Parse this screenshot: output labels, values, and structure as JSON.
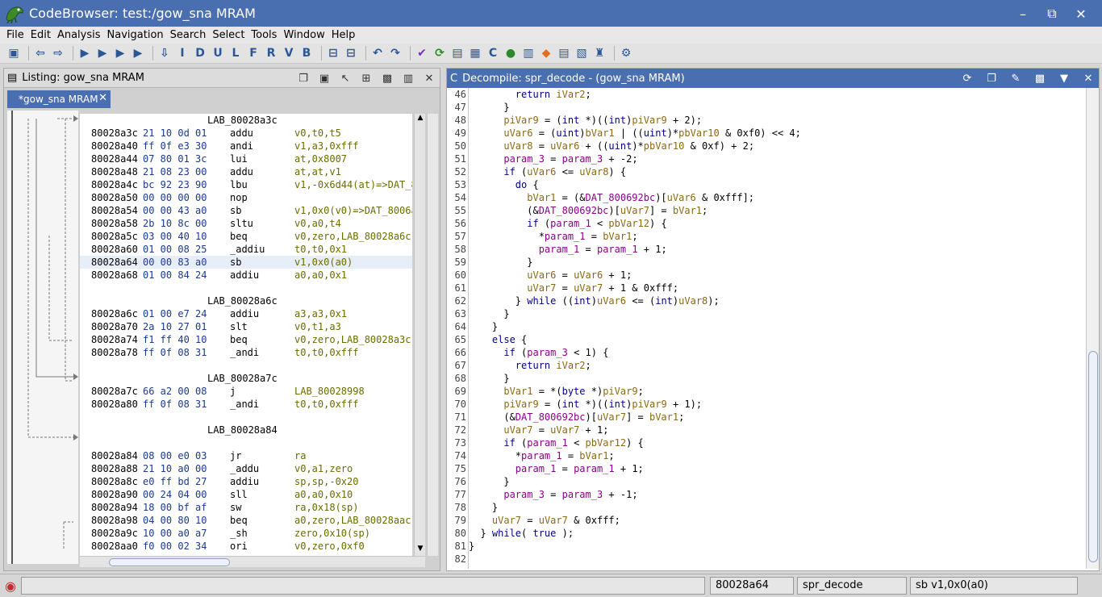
{
  "window": {
    "title": "CodeBrowser: test:/gow_sna MRAM",
    "min": "–",
    "max": "☐",
    "restore": "⧉",
    "close": "✕"
  },
  "menu": [
    "File",
    "Edit",
    "Analysis",
    "Navigation",
    "Search",
    "Select",
    "Tools",
    "Window",
    "Help"
  ],
  "listing": {
    "title": "Listing:  gow_sna MRAM",
    "tab": "*gow_sna MRAM",
    "rows": [
      {
        "type": "label",
        "text": "LAB_80028a3c"
      },
      {
        "type": "insn",
        "addr": "80028a3c",
        "bytes": "21 10 0d 01",
        "mn": "addu",
        "op": "v0,t0,t5"
      },
      {
        "type": "insn",
        "addr": "80028a40",
        "bytes": "ff 0f e3 30",
        "mn": "andi",
        "op": "v1,a3,0xfff"
      },
      {
        "type": "insn",
        "addr": "80028a44",
        "bytes": "07 80 01 3c",
        "mn": "lui",
        "op": "at,0x8007"
      },
      {
        "type": "insn",
        "addr": "80028a48",
        "bytes": "21 08 23 00",
        "mn": "addu",
        "op": "at,at,v1"
      },
      {
        "type": "insn",
        "addr": "80028a4c",
        "bytes": "bc 92 23 90",
        "mn": "lbu",
        "op": "v1,-0x6d44(at)=>DAT_8"
      },
      {
        "type": "insn",
        "addr": "80028a50",
        "bytes": "00 00 00 00",
        "mn": "nop",
        "op": ""
      },
      {
        "type": "insn",
        "addr": "80028a54",
        "bytes": "00 00 43 a0",
        "mn": "sb",
        "op": "v1,0x0(v0)=>DAT_8006a"
      },
      {
        "type": "insn",
        "addr": "80028a58",
        "bytes": "2b 10 8c 00",
        "mn": "sltu",
        "op": "v0,a0,t4"
      },
      {
        "type": "insn",
        "addr": "80028a5c",
        "bytes": "03 00 40 10",
        "mn": "beq",
        "op": "v0,zero,LAB_80028a6c"
      },
      {
        "type": "insn",
        "addr": "80028a60",
        "bytes": "01 00 08 25",
        "mn": "_addiu",
        "op": "t0,t0,0x1"
      },
      {
        "type": "insn",
        "addr": "80028a64",
        "bytes": "00 00 83 a0",
        "mn": "sb",
        "op": "v1,0x0(a0)",
        "sel": true
      },
      {
        "type": "insn",
        "addr": "80028a68",
        "bytes": "01 00 84 24",
        "mn": "addiu",
        "op": "a0,a0,0x1"
      },
      {
        "type": "blank"
      },
      {
        "type": "label",
        "text": "LAB_80028a6c"
      },
      {
        "type": "insn",
        "addr": "80028a6c",
        "bytes": "01 00 e7 24",
        "mn": "addiu",
        "op": "a3,a3,0x1"
      },
      {
        "type": "insn",
        "addr": "80028a70",
        "bytes": "2a 10 27 01",
        "mn": "slt",
        "op": "v0,t1,a3"
      },
      {
        "type": "insn",
        "addr": "80028a74",
        "bytes": "f1 ff 40 10",
        "mn": "beq",
        "op": "v0,zero,LAB_80028a3c"
      },
      {
        "type": "insn",
        "addr": "80028a78",
        "bytes": "ff 0f 08 31",
        "mn": "_andi",
        "op": "t0,t0,0xfff"
      },
      {
        "type": "blank"
      },
      {
        "type": "label",
        "text": "LAB_80028a7c"
      },
      {
        "type": "insn",
        "addr": "80028a7c",
        "bytes": "66 a2 00 08",
        "mn": "j",
        "op": "LAB_80028998"
      },
      {
        "type": "insn",
        "addr": "80028a80",
        "bytes": "ff 0f 08 31",
        "mn": "_andi",
        "op": "t0,t0,0xfff"
      },
      {
        "type": "blank"
      },
      {
        "type": "label",
        "text": "LAB_80028a84"
      },
      {
        "type": "blank"
      },
      {
        "type": "insn",
        "addr": "80028a84",
        "bytes": "08 00 e0 03",
        "mn": "jr",
        "op": "ra"
      },
      {
        "type": "insn",
        "addr": "80028a88",
        "bytes": "21 10 a0 00",
        "mn": "_addu",
        "op": "v0,a1,zero"
      },
      {
        "type": "insn",
        "addr": "80028a8c",
        "bytes": "e0 ff bd 27",
        "mn": "addiu",
        "op": "sp,sp,-0x20"
      },
      {
        "type": "insn",
        "addr": "80028a90",
        "bytes": "00 24 04 00",
        "mn": "sll",
        "op": "a0,a0,0x10"
      },
      {
        "type": "insn",
        "addr": "80028a94",
        "bytes": "18 00 bf af",
        "mn": "sw",
        "op": "ra,0x18(sp)"
      },
      {
        "type": "insn",
        "addr": "80028a98",
        "bytes": "04 00 80 10",
        "mn": "beq",
        "op": "a0,zero,LAB_80028aac"
      },
      {
        "type": "insn",
        "addr": "80028a9c",
        "bytes": "10 00 a0 a7",
        "mn": "_sh",
        "op": "zero,0x10(sp)"
      },
      {
        "type": "insn",
        "addr": "80028aa0",
        "bytes": "f0 00 02 34",
        "mn": "ori",
        "op": "v0,zero,0xf0"
      }
    ]
  },
  "decompile": {
    "title": "Decompile: spr_decode -  (gow_sna MRAM)",
    "lines": [
      {
        "n": "46",
        "t": "        return iVar2;"
      },
      {
        "n": "47",
        "t": "      }"
      },
      {
        "n": "48",
        "t": "      piVar9 = (int *)((int)piVar9 + 2);"
      },
      {
        "n": "49",
        "t": "      uVar6 = (uint)bVar1 | ((uint)*pbVar10 & 0xf0) << 4;"
      },
      {
        "n": "50",
        "t": "      uVar8 = uVar6 + ((uint)*pbVar10 & 0xf) + 2;"
      },
      {
        "n": "51",
        "t": "      param_3 = param_3 + -2;"
      },
      {
        "n": "52",
        "t": "      if (uVar6 <= uVar8) {"
      },
      {
        "n": "53",
        "t": "        do {"
      },
      {
        "n": "54",
        "t": "          bVar1 = (&DAT_800692bc)[uVar6 & 0xfff];"
      },
      {
        "n": "55",
        "t": "          (&DAT_800692bc)[uVar7] = bVar1;"
      },
      {
        "n": "56",
        "t": "          if (param_1 < pbVar12) {"
      },
      {
        "n": "57",
        "t": "            *param_1 = bVar1;"
      },
      {
        "n": "58",
        "t": "            param_1 = param_1 + 1;"
      },
      {
        "n": "59",
        "t": "          }"
      },
      {
        "n": "60",
        "t": "          uVar6 = uVar6 + 1;"
      },
      {
        "n": "61",
        "t": "          uVar7 = uVar7 + 1 & 0xfff;"
      },
      {
        "n": "62",
        "t": "        } while ((int)uVar6 <= (int)uVar8);"
      },
      {
        "n": "63",
        "t": "      }"
      },
      {
        "n": "64",
        "t": "    }"
      },
      {
        "n": "65",
        "t": "    else {"
      },
      {
        "n": "66",
        "t": "      if (param_3 < 1) {"
      },
      {
        "n": "67",
        "t": "        return iVar2;"
      },
      {
        "n": "68",
        "t": "      }"
      },
      {
        "n": "69",
        "t": "      bVar1 = *(byte *)piVar9;"
      },
      {
        "n": "70",
        "t": "      piVar9 = (int *)((int)piVar9 + 1);"
      },
      {
        "n": "71",
        "t": "      (&DAT_800692bc)[uVar7] = bVar1;"
      },
      {
        "n": "72",
        "t": "      uVar7 = uVar7 + 1;"
      },
      {
        "n": "73",
        "t": "      if (param_1 < pbVar12) {"
      },
      {
        "n": "74",
        "t": "        *param_1 = bVar1;"
      },
      {
        "n": "75",
        "t": "        param_1 = param_1 + 1;"
      },
      {
        "n": "76",
        "t": "      }"
      },
      {
        "n": "77",
        "t": "      param_3 = param_3 + -1;"
      },
      {
        "n": "78",
        "t": "    }"
      },
      {
        "n": "79",
        "t": "    uVar7 = uVar7 & 0xfff;"
      },
      {
        "n": "80",
        "t": "  } while( true );"
      },
      {
        "n": "81",
        "t": "}"
      },
      {
        "n": "82",
        "t": ""
      }
    ]
  },
  "status": {
    "address": "80028a64",
    "function": "spr_decode",
    "instruction": "sb v1,0x0(a0)"
  },
  "colors": {
    "titlebar": "#4a6fb0",
    "keyword": "#00008b",
    "function": "#8b008b"
  }
}
